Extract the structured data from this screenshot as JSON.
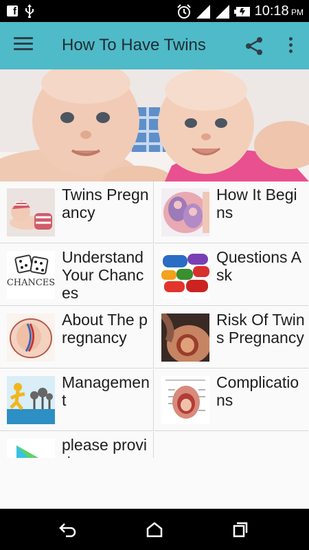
{
  "status_bar": {
    "time": "10:18",
    "ampm": "PM",
    "icons": [
      "facebook-icon",
      "usb-icon",
      "alarm-icon",
      "signal-icon",
      "signal-icon",
      "battery-icon"
    ]
  },
  "app_bar": {
    "title": "How To Have Twins",
    "menu_icon": "hamburger-menu-icon",
    "share_icon": "share-icon",
    "more_icon": "more-vert-icon"
  },
  "hero": {
    "image": "twin-babies-photo"
  },
  "items": [
    {
      "label": "Twins Pregnancy",
      "thumb": "sleeping-baby-photo"
    },
    {
      "label": "How It Begins",
      "thumb": "twin-fetus-illustration"
    },
    {
      "label": "Understand Your Chances",
      "thumb": "dice-chances-image"
    },
    {
      "label": "Questions Ask",
      "thumb": "question-bubbles-image"
    },
    {
      "label": "About The pregnancy",
      "thumb": "fetus-diagram-image"
    },
    {
      "label": "Risk Of Twins Pregnancy",
      "thumb": "pregnant-belly-photo"
    },
    {
      "label": "Management",
      "thumb": "runner-illustration"
    },
    {
      "label": "Complications",
      "thumb": "uterus-diagram-image"
    },
    {
      "label": "please provide",
      "thumb": "play-store-icon"
    }
  ],
  "nav_bar": {
    "back_icon": "back-icon",
    "home_icon": "home-icon",
    "recents_icon": "recents-icon"
  }
}
